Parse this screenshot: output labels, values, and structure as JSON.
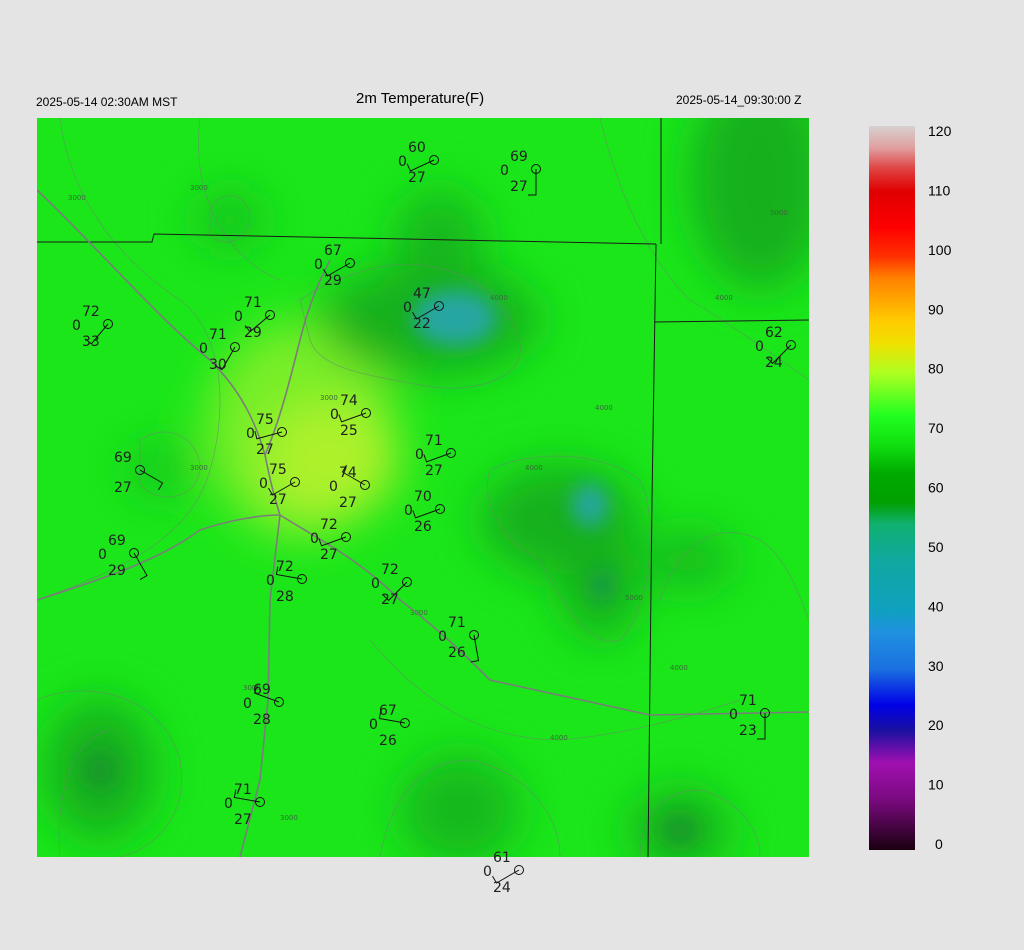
{
  "header": {
    "local_time": "2025-05-14 02:30AM MST",
    "title": "2m Temperature(F)",
    "utc_time": "2025-05-14_09:30:00 Z"
  },
  "colorbar": {
    "ticks": [
      "0",
      "10",
      "20",
      "30",
      "40",
      "50",
      "60",
      "70",
      "80",
      "90",
      "100",
      "110",
      "120"
    ],
    "range": [
      0,
      122
    ]
  },
  "colors": {
    "map_base": "#19e619",
    "warm": "#b8f02a",
    "cool": "#14b41e",
    "cold": "#1fa6a6",
    "background": "#e4e4e4"
  },
  "contour_labels": [
    "3000",
    "4000",
    "5000"
  ],
  "stations": [
    {
      "id": "s1",
      "temp": "60",
      "dew": "27",
      "cloud": "0"
    },
    {
      "id": "s2",
      "temp": "69",
      "dew": "27",
      "cloud": "0"
    },
    {
      "id": "s3",
      "temp": "67",
      "dew": "29",
      "cloud": "0"
    },
    {
      "id": "s4",
      "temp": "72",
      "dew": "33",
      "cloud": "0"
    },
    {
      "id": "s5",
      "temp": "71",
      "dew": "29",
      "cloud": "0"
    },
    {
      "id": "s6",
      "temp": "71",
      "dew": "30",
      "cloud": "0"
    },
    {
      "id": "s7",
      "temp": "47",
      "dew": "22",
      "cloud": "0"
    },
    {
      "id": "s8",
      "temp": "62",
      "dew": "24",
      "cloud": "0"
    },
    {
      "id": "s9",
      "temp": "75",
      "dew": "27",
      "cloud": "0"
    },
    {
      "id": "s10",
      "temp": "74",
      "dew": "25",
      "cloud": "0"
    },
    {
      "id": "s11",
      "temp": "69",
      "dew": "27",
      "cloud": ""
    },
    {
      "id": "s12",
      "temp": "75",
      "dew": "27",
      "cloud": "0"
    },
    {
      "id": "s13",
      "temp": "74",
      "dew": "27",
      "cloud": "0"
    },
    {
      "id": "s14",
      "temp": "71",
      "dew": "27",
      "cloud": "0"
    },
    {
      "id": "s15",
      "temp": "70",
      "dew": "26",
      "cloud": "0"
    },
    {
      "id": "s16",
      "temp": "69",
      "dew": "29",
      "cloud": "0"
    },
    {
      "id": "s17",
      "temp": "72",
      "dew": "27",
      "cloud": "0"
    },
    {
      "id": "s18",
      "temp": "72",
      "dew": "28",
      "cloud": "0"
    },
    {
      "id": "s19",
      "temp": "72",
      "dew": "27",
      "cloud": "0"
    },
    {
      "id": "s20",
      "temp": "71",
      "dew": "26",
      "cloud": "0"
    },
    {
      "id": "s21",
      "temp": "69",
      "dew": "28",
      "cloud": "0"
    },
    {
      "id": "s22",
      "temp": "67",
      "dew": "26",
      "cloud": "0"
    },
    {
      "id": "s23",
      "temp": "71",
      "dew": "23",
      "cloud": "0"
    },
    {
      "id": "s24",
      "temp": "71",
      "dew": "27",
      "cloud": "0"
    },
    {
      "id": "s25",
      "temp": "61",
      "dew": "24",
      "cloud": "0"
    }
  ]
}
